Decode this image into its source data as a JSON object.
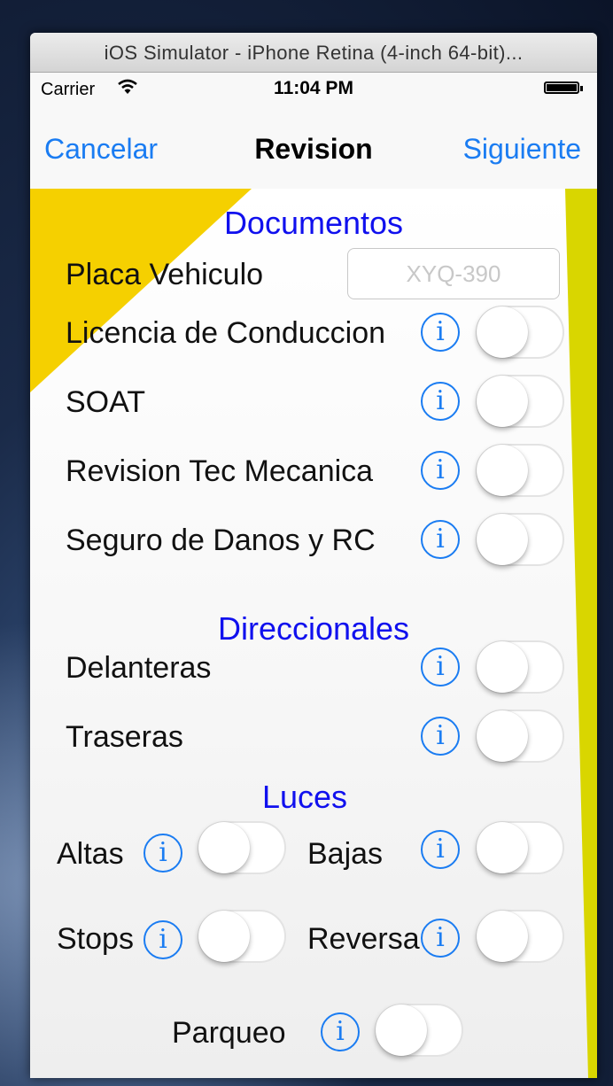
{
  "window": {
    "title": "iOS Simulator - iPhone Retina (4-inch 64-bit)..."
  },
  "status_bar": {
    "carrier": "Carrier",
    "time": "11:04 PM"
  },
  "nav": {
    "left": "Cancelar",
    "title": "Revision",
    "right": "Siguiente"
  },
  "documentos": {
    "title": "Documentos",
    "plate_label": "Placa Vehiculo",
    "plate_placeholder": "XYQ-390",
    "items": [
      {
        "label": "Licencia de Conduccion",
        "on": false
      },
      {
        "label": "SOAT",
        "on": false
      },
      {
        "label": "Revision Tec Mecanica",
        "on": false
      },
      {
        "label": "Seguro de Danos y RC",
        "on": false
      }
    ]
  },
  "direccionales": {
    "title": "Direccionales",
    "items": [
      {
        "label": "Delanteras",
        "on": false
      },
      {
        "label": "Traseras",
        "on": false
      }
    ]
  },
  "luces": {
    "title": "Luces",
    "items": [
      {
        "label": "Altas",
        "on": false
      },
      {
        "label": "Bajas",
        "on": false
      },
      {
        "label": "Stops",
        "on": false
      },
      {
        "label": "Reversa",
        "on": false
      },
      {
        "label": "Parqueo",
        "on": false
      }
    ]
  },
  "info_glyph": "i",
  "colors": {
    "accent": "#1a7cf2",
    "section": "#1010ee",
    "yellow": "#f5d000",
    "yellow_right": "#d9d600"
  }
}
